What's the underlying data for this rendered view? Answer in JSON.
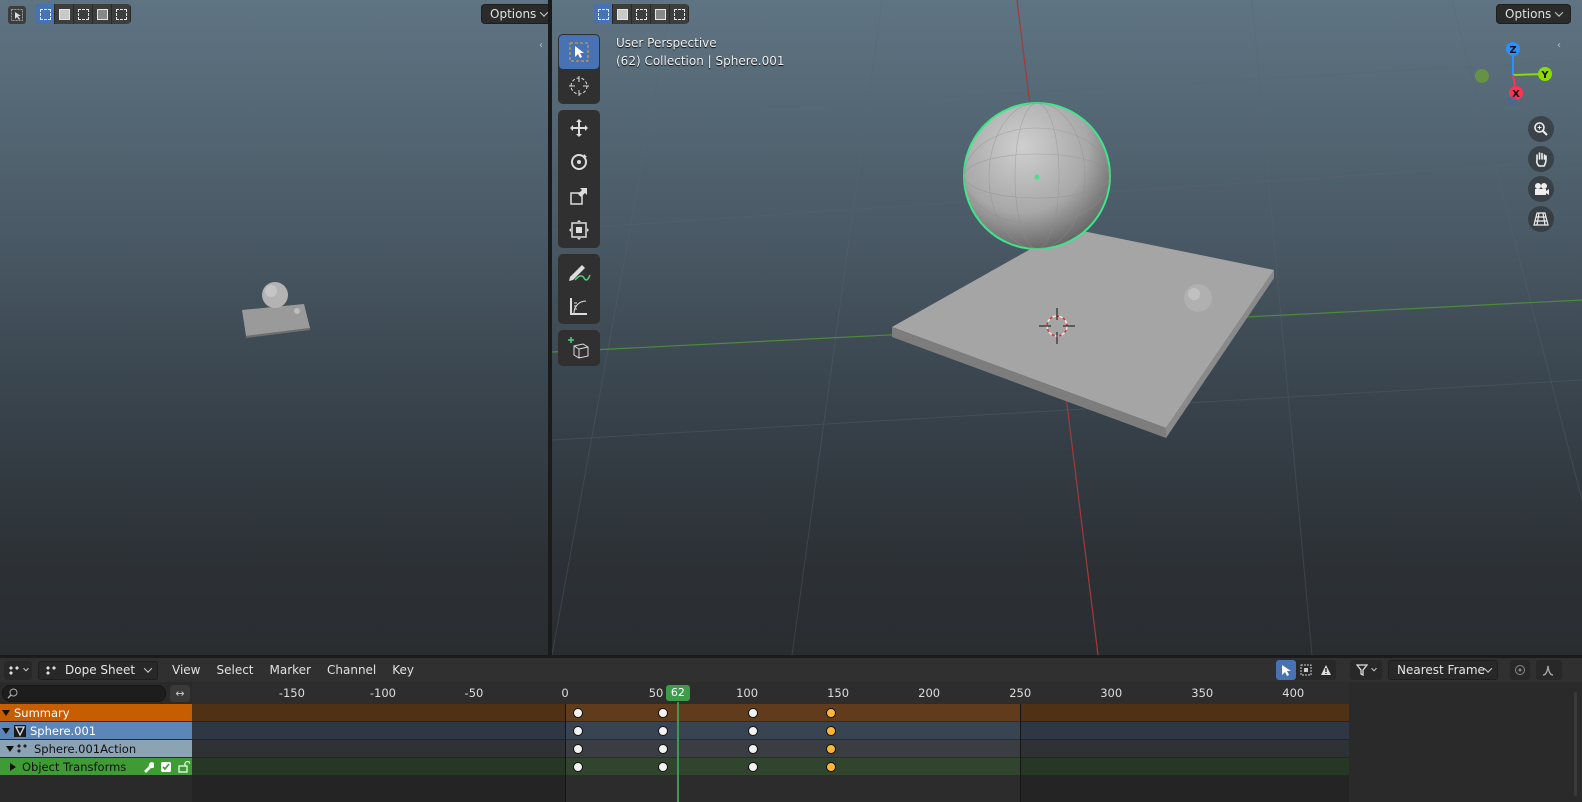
{
  "left_viewport": {
    "options_label": "Options",
    "select_modes": [
      "select-box-icon",
      "extend-icon",
      "subtract-icon",
      "difference-icon",
      "intersect-icon"
    ]
  },
  "right_viewport": {
    "options_label": "Options",
    "info_line1": "User Perspective",
    "info_line2": "(62) Collection | Sphere.001",
    "gizmo": {
      "z": "Z",
      "y": "Y",
      "x": "X"
    },
    "colors": {
      "axis_x": "#ff3352",
      "axis_y": "#8bdc00",
      "axis_z": "#2890ff",
      "selection_outline": "#3fe58b"
    }
  },
  "dopesheet": {
    "mode_label": "Dope Sheet",
    "menus": [
      "View",
      "Select",
      "Marker",
      "Channel",
      "Key"
    ],
    "snapping_label": "Nearest Frame",
    "channels": {
      "summary": "Summary",
      "object": "Sphere.001",
      "action": "Sphere.001Action",
      "group": "Object Transforms"
    },
    "ruler_ticks": [
      "-150",
      "-100",
      "-50",
      "0",
      "50",
      "100",
      "150",
      "200",
      "250",
      "300",
      "350",
      "400"
    ],
    "current_frame": "62",
    "scene_end_frame": 250,
    "keyframes": [
      {
        "frame": 7,
        "selected": false
      },
      {
        "frame": 54,
        "selected": false
      },
      {
        "frame": 103,
        "selected": false
      },
      {
        "frame": 146,
        "selected": true
      }
    ],
    "colors": {
      "summary": "#c65d00",
      "object": "#5c86b8",
      "action": "#8ca3b6",
      "group": "#3f9c35",
      "playhead": "#3e9b4c",
      "selected_key": "#ffb635"
    }
  }
}
